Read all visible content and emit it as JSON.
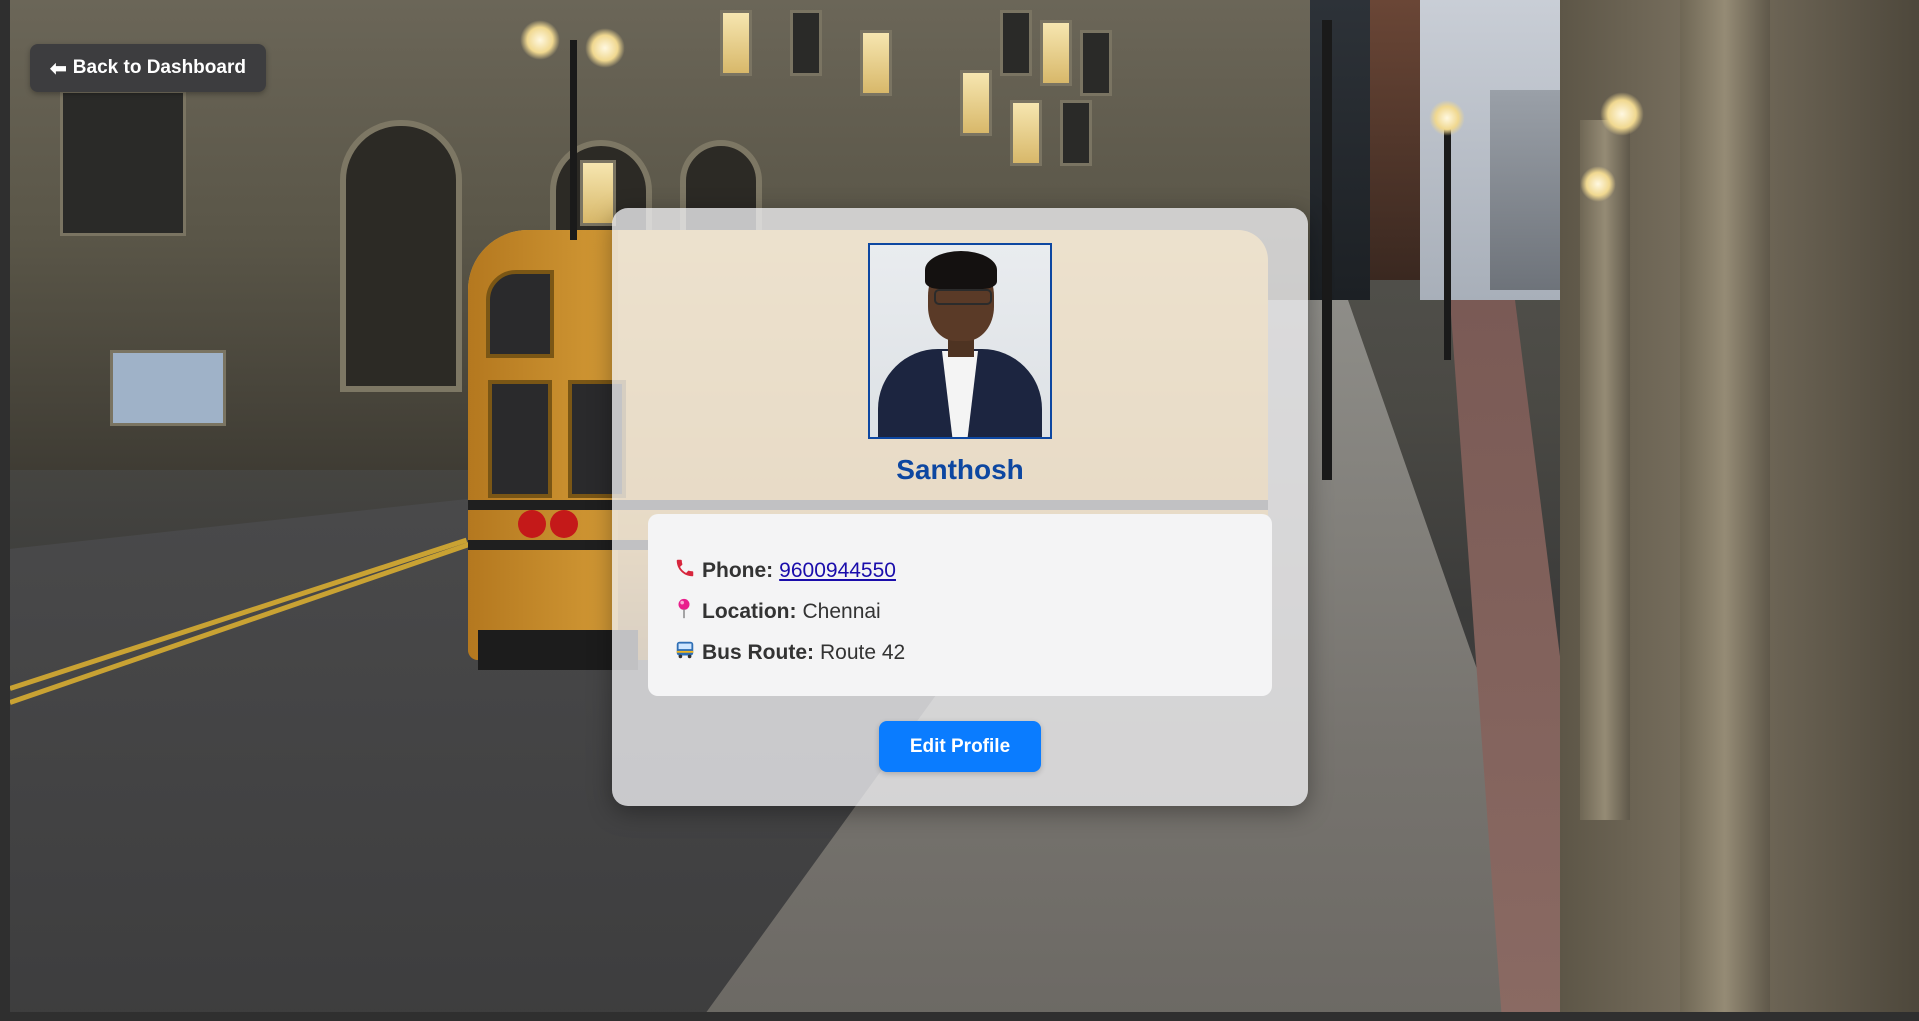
{
  "nav": {
    "back_arrow": "⬅",
    "back_label": "Back to Dashboard"
  },
  "profile": {
    "name": "Santhosh",
    "photo_alt": "Santhosh",
    "phone_icon": "phone-icon",
    "phone_label": "Phone:",
    "phone_value": "9600944550",
    "location_icon": "pin-icon",
    "location_label": "Location:",
    "location_value": "Chennai",
    "bus_icon": "bus-icon",
    "bus_label": "Bus Route:",
    "bus_value": "Route 42",
    "edit_label": "Edit Profile"
  },
  "colors": {
    "accent": "#0a7cff",
    "name": "#0d47a1",
    "back_button": "#3d3d3f"
  }
}
